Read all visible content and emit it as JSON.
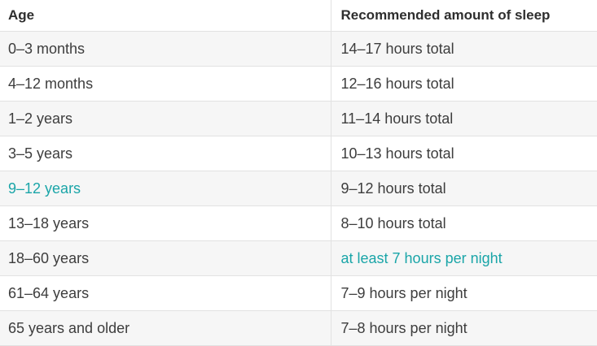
{
  "table": {
    "headers": {
      "age": "Age",
      "sleep": "Recommended amount of sleep"
    },
    "link_color": "#1aa5a8",
    "rows": [
      {
        "age": "0–3 months",
        "sleep": "14–17 hours total"
      },
      {
        "age": "4–12 months",
        "sleep": "12–16 hours total"
      },
      {
        "age": "1–2 years",
        "sleep": "11–14 hours total"
      },
      {
        "age": "3–5 years",
        "sleep": "10–13 hours total"
      },
      {
        "age": "9–12 years",
        "sleep": "9–12 hours total",
        "age_is_link": true
      },
      {
        "age": "13–18 years",
        "sleep": "8–10 hours total"
      },
      {
        "age": "18–60 years",
        "sleep": "at least 7 hours per night",
        "sleep_is_link": true
      },
      {
        "age": "61–64 years",
        "sleep": "7–9 hours per night"
      },
      {
        "age": "65 years and older",
        "sleep": "7–8 hours per night"
      }
    ]
  }
}
